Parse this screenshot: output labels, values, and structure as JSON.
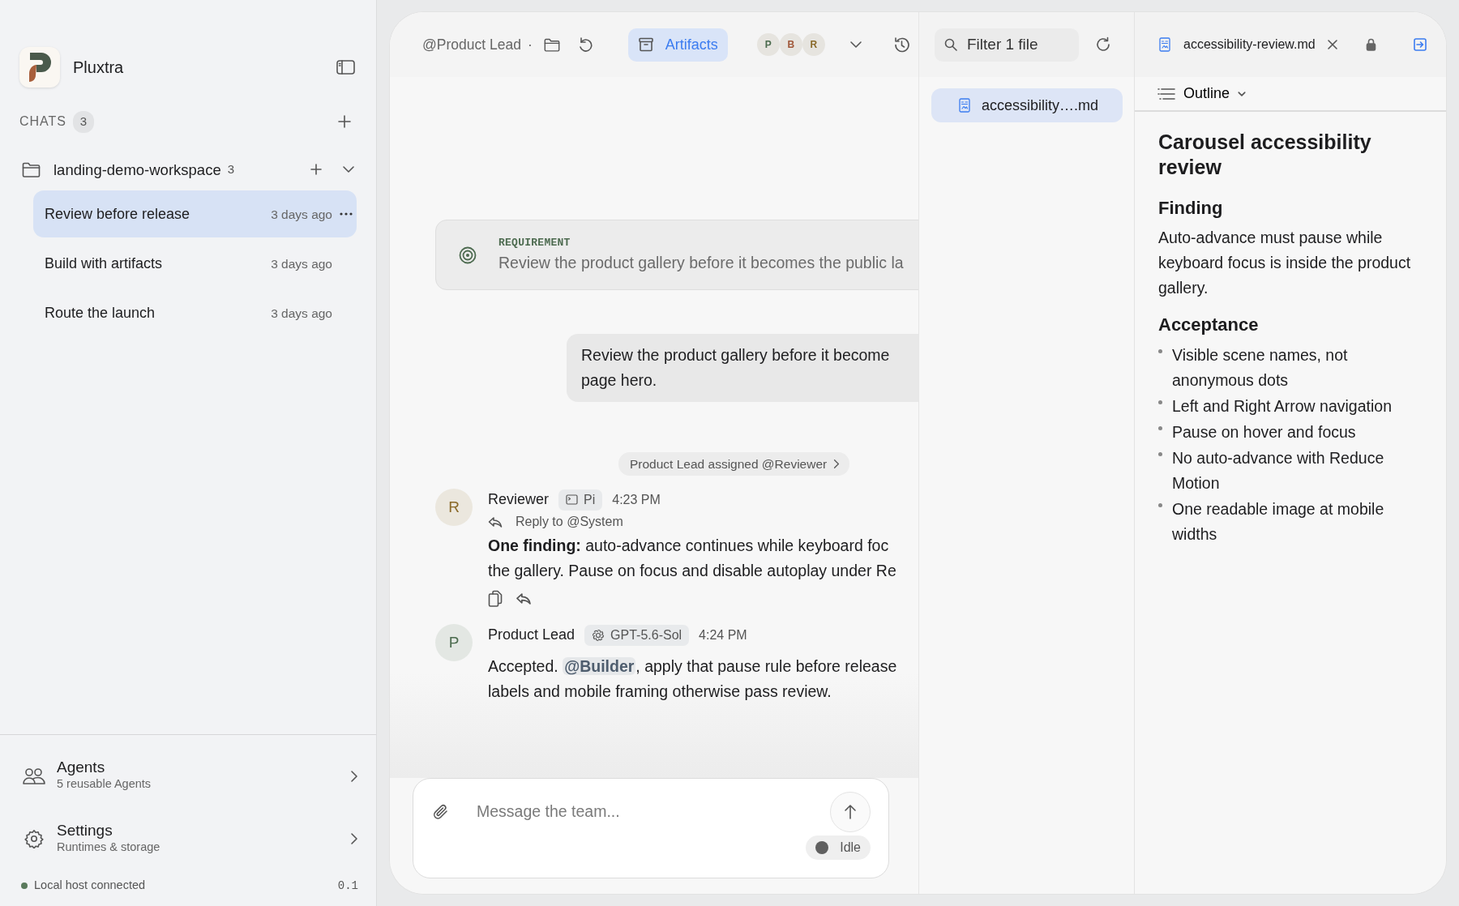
{
  "app": {
    "name": "Pluxtra"
  },
  "sidebar": {
    "chats_label": "CHATS",
    "chats_count": "3",
    "workspace": {
      "name": "landing-demo-workspace",
      "count": "3",
      "expanded": true
    },
    "chats": [
      {
        "title": "Review before release",
        "time": "3 days ago",
        "selected": true
      },
      {
        "title": "Build with artifacts",
        "time": "3 days ago",
        "selected": false
      },
      {
        "title": "Route the launch",
        "time": "3 days ago",
        "selected": false
      }
    ],
    "footer_items": [
      {
        "kind": "agents",
        "title": "Agents",
        "subtitle": "5 reusable Agents"
      },
      {
        "kind": "settings",
        "title": "Settings",
        "subtitle": "Runtimes & storage"
      }
    ],
    "status": {
      "text": "Local host connected",
      "version": "0.1",
      "connected": true
    }
  },
  "chat": {
    "header": {
      "owner": "@Product Lead",
      "separator": "·",
      "artifacts": {
        "label": "Artifacts",
        "selected": true
      },
      "participants": [
        {
          "initial": "P",
          "color": "#4b6b4e"
        },
        {
          "initial": "B",
          "color": "#a0583a"
        },
        {
          "initial": "R",
          "color": "#8a6a2a"
        }
      ]
    },
    "requirement": {
      "label": "REQUIREMENT",
      "text": "Review the product gallery before it becomes the public la"
    },
    "user_message": {
      "lines": [
        "Review the product gallery before it become",
        "page hero."
      ]
    },
    "event": {
      "text": "Product Lead assigned @Reviewer"
    },
    "messages": [
      {
        "author": "Reviewer",
        "initial": "R",
        "color": "#8a6a2a",
        "model": "Pi",
        "kind": "terminal",
        "time": "4:23 PM",
        "reply_to": "Reply to @System",
        "actions": true,
        "lines": [
          [
            {
              "kind": "plain",
              "text": "**One finding:** auto-advance continues while keyboard foc"
            }
          ],
          [
            {
              "kind": "plain",
              "text": "the gallery. Pause on focus and disable autoplay under Re"
            }
          ]
        ]
      },
      {
        "author": "Product Lead",
        "initial": "P",
        "color": "#4b6b4e",
        "model": "GPT-5.6-Sol",
        "kind": "flower",
        "time": "4:24 PM",
        "actions": false,
        "lines": [
          [
            {
              "kind": "plain",
              "text": "Accepted. "
            },
            {
              "kind": "mention",
              "text": "@Builder"
            },
            {
              "kind": "plain",
              "text": ", apply that pause rule before release"
            }
          ],
          [
            {
              "kind": "plain",
              "text": "labels and mobile framing otherwise pass review."
            }
          ]
        ]
      }
    ],
    "composer": {
      "placeholder": "Message the team...",
      "status": "Idle"
    }
  },
  "files": {
    "filter_placeholder": "Filter 1 file",
    "items": [
      {
        "name": "accessibility….md",
        "selected": true
      }
    ]
  },
  "document": {
    "tab": "accessibility-review.md",
    "outline": "Outline",
    "title": "Carousel accessibility review",
    "sections": [
      {
        "heading": "Finding",
        "paragraph": "Auto-advance must pause while keyboard focus is inside the product gallery."
      },
      {
        "heading": "Acceptance",
        "bullets": [
          "Visible scene names, not anonymous dots",
          "Left and Right Arrow navigation",
          "Pause on hover and focus",
          "No auto-advance with Reduce Motion",
          "One readable image at mobile widths"
        ]
      }
    ]
  }
}
